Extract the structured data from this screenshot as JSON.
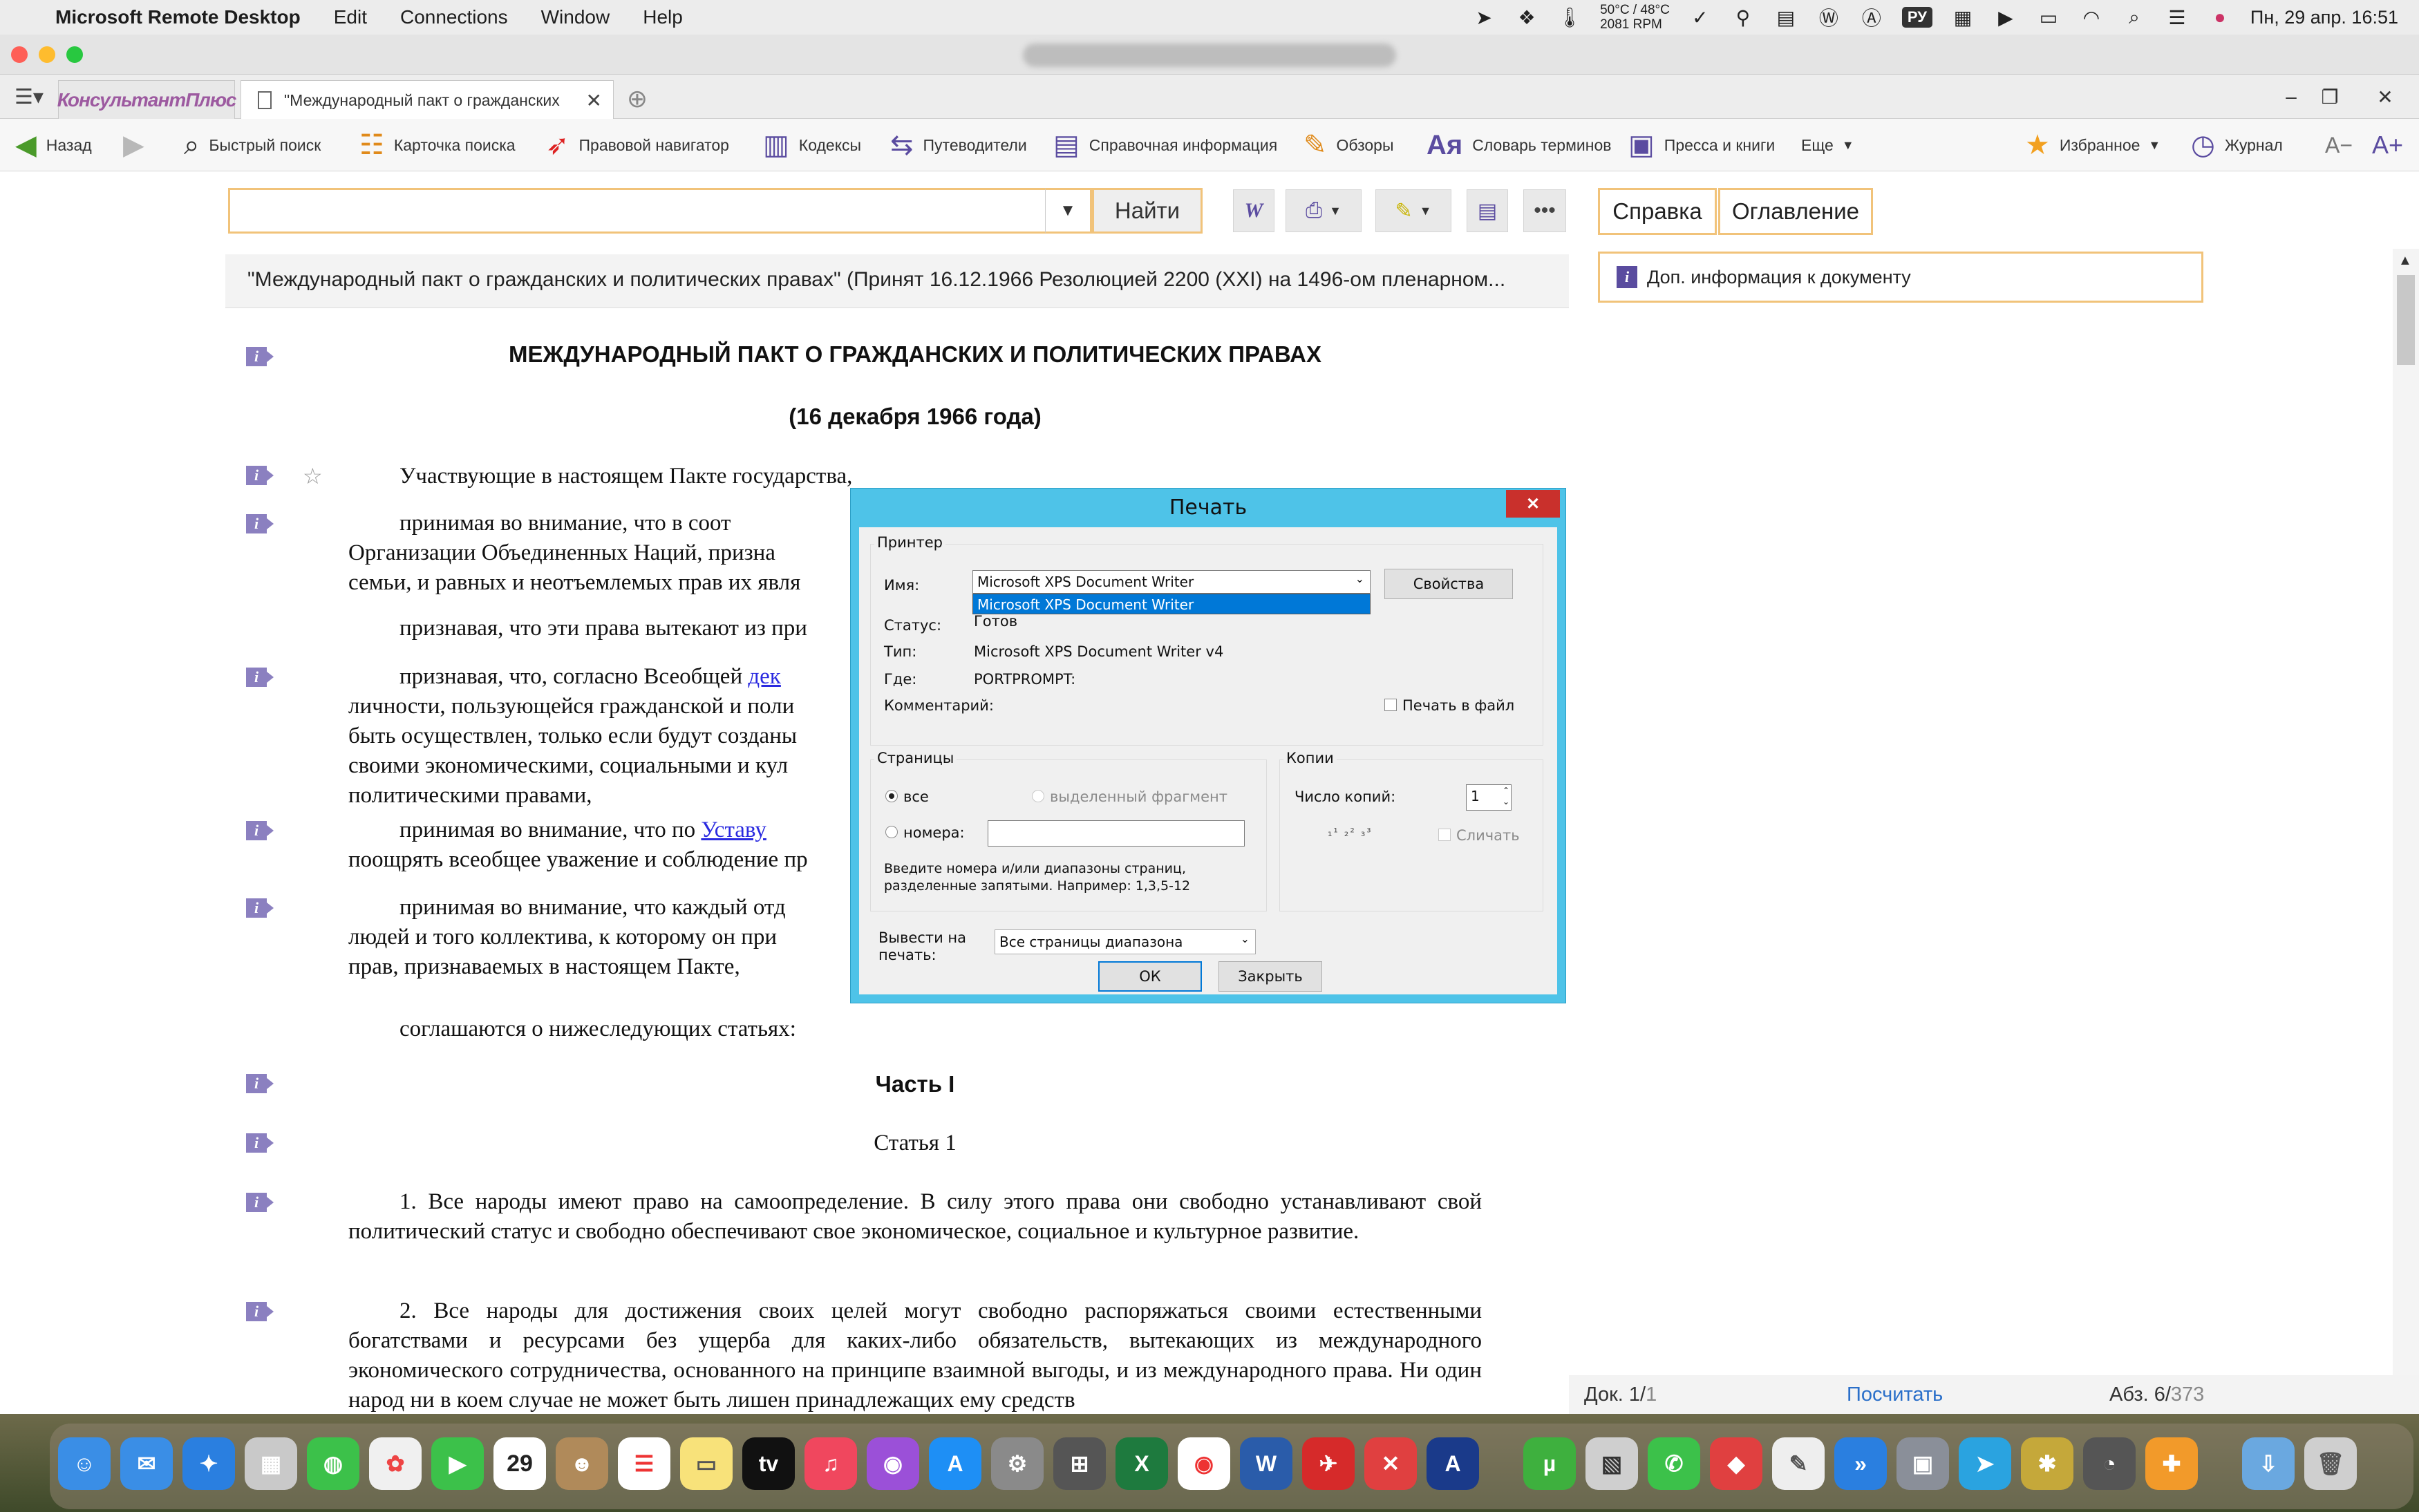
{
  "menubar": {
    "app_name": "Microsoft Remote Desktop",
    "menus": [
      "Edit",
      "Connections",
      "Window",
      "Help"
    ],
    "sensor_temp": "50°C / 48°C",
    "sensor_rpm": "2081 RPM",
    "input_lang": "РУ",
    "datetime": "Пн, 29 апр.  16:51"
  },
  "tabs": {
    "app_tab": "КонсультантПлюс",
    "doc_tab": "\"Международный пакт о гражданских и п"
  },
  "toolbar": {
    "back": "Назад",
    "quick_search": "Быстрый поиск",
    "search_card": "Карточка поиска",
    "legal_nav": "Правовой навигатор",
    "codes": "Кодексы",
    "guides": "Путеводители",
    "reference": "Справочная информация",
    "reviews": "Обзоры",
    "dictionary": "Словарь терминов",
    "press": "Пресса и книги",
    "more": "Еще",
    "favorites": "Избранное",
    "journal": "Журнал",
    "font_minus": "A−",
    "font_plus": "A+"
  },
  "search": {
    "find_label": "Найти",
    "value": ""
  },
  "right_panel": {
    "tab_help": "Справка",
    "tab_toc": "Оглавление",
    "dop_info": "Доп. информация к документу"
  },
  "document": {
    "header": "\"Международный пакт о гражданских и политических правах\" (Принят 16.12.1966 Резолюцией 2200 (XXI) на 1496-ом пленарном...",
    "title": "МЕЖДУНАРОДНЫЙ ПАКТ О ГРАЖДАНСКИХ И ПОЛИТИЧЕСКИХ ПРАВАХ",
    "date": "(16 декабря 1966 года)",
    "p1": "Участвующие в настоящем Пакте государства,",
    "p2a": "принимая во внимание, что в соот",
    "p2b": "Организации Объединенных Наций, призна",
    "p2c": "семьи, и равных и неотъемлемых прав их явля",
    "p3": "признавая, что эти права вытекают из при",
    "p4a": "признавая, что, согласно Всеобщей",
    "p4link": "дек",
    "p4b": "личности, пользующейся гражданской и поли",
    "p4c": "быть осуществлен, только если будут созданы",
    "p4d": "своими экономическими, социальными и кул",
    "p4e": "политическими правами,",
    "p5a": "принимая во внимание, что по",
    "p5link": "Уставу",
    "p5b": "поощрять всеобщее уважение и соблюдение пр",
    "p6a": "принимая во внимание, что каждый отд",
    "p6b": "людей и того коллектива, к которому он при",
    "p6c": "прав, признаваемых в настоящем Пакте,",
    "p7": "соглашаются о нижеследующих статьях:",
    "part": "Часть I",
    "article": "Статья 1",
    "a1": "1. Все народы имеют право на самоопределение. В силу этого права они свободно устанавливают свой политический статус и свободно обеспечивают свое экономическое, социальное и культурное развитие.",
    "a2": "2. Все народы для достижения своих целей могут свободно распоряжаться своими естественными богатствами и ресурсами без ущерба для каких-либо обязательств, вытекающих из международного экономического сотрудничества, основанного на принципе взаимной выгоды, и из международного права. Ни один народ ни в коем случае не может быть лишен принадлежащих ему средств"
  },
  "status": {
    "doc_label": "Док. 1/",
    "doc_total": "1",
    "count": "Посчитать",
    "abz_label": "Абз. 6/",
    "abz_total": "373"
  },
  "print_dialog": {
    "title": "Печать",
    "printer_group": "Принтер",
    "name_label": "Имя:",
    "name_value": "Microsoft XPS Document Writer",
    "dropdown_option": "Microsoft XPS Document Writer",
    "properties": "Свойства",
    "status_label": "Статус:",
    "status_value": "Готов",
    "type_label": "Тип:",
    "type_value": "Microsoft XPS Document Writer v4",
    "where_label": "Где:",
    "where_value": "PORTPROMPT:",
    "comment_label": "Комментарий:",
    "print_to_file": "Печать в файл",
    "pages_group": "Страницы",
    "all": "все",
    "selection": "выделенный фрагмент",
    "numbers": "номера:",
    "pages_hint": "Введите номера и/или диапазоны страниц, разделенные запятыми. Например: 1,3,5-12",
    "copies_group": "Копии",
    "copies_label": "Число копий:",
    "copies_value": "1",
    "collate": "Сличать",
    "output_label": "Вывести на печать:",
    "output_value": "Все страницы диапазона",
    "ok": "ОК",
    "close": "Закрыть"
  },
  "colors": {
    "accent_orange": "#f1c37a",
    "dialog_frame": "#4ec3e8",
    "marker_purple": "#8b80c0",
    "link_blue": "#2a2ae0"
  }
}
